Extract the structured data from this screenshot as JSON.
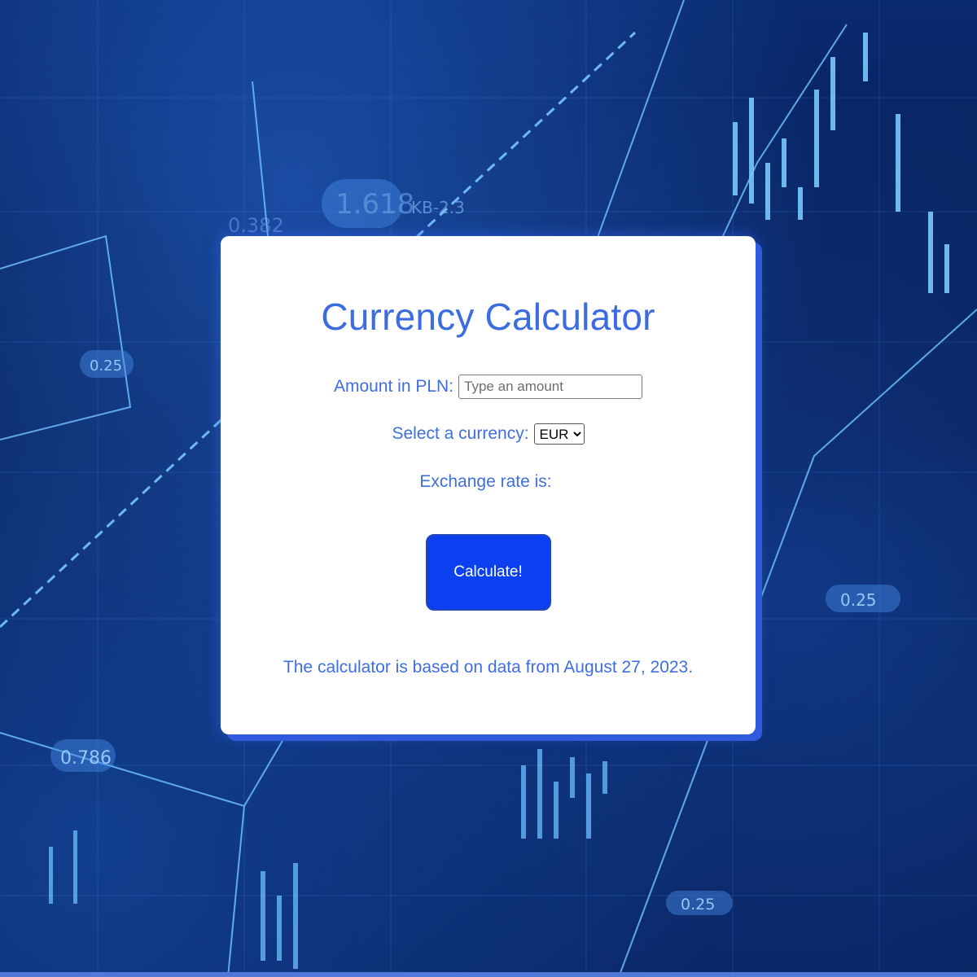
{
  "card": {
    "title": "Currency Calculator",
    "amount_label": "Amount in PLN:",
    "amount_placeholder": "Type an amount",
    "amount_value": "",
    "currency_label": "Select a currency:",
    "currency_selected": "EUR",
    "rate_label": "Exchange rate is:",
    "rate_value": "",
    "calculate_label": "Calculate!",
    "footer_note": "The calculator is based on data from August 27, 2023."
  },
  "background": {
    "labels": [
      "0.25",
      "0.786",
      "1.618",
      "0.25",
      "0.25",
      "KB-2.3",
      "0.382"
    ]
  },
  "colors": {
    "accent": "#3f6ee0",
    "button": "#0b3ff0",
    "card_shadow": "#2f5bdc"
  }
}
